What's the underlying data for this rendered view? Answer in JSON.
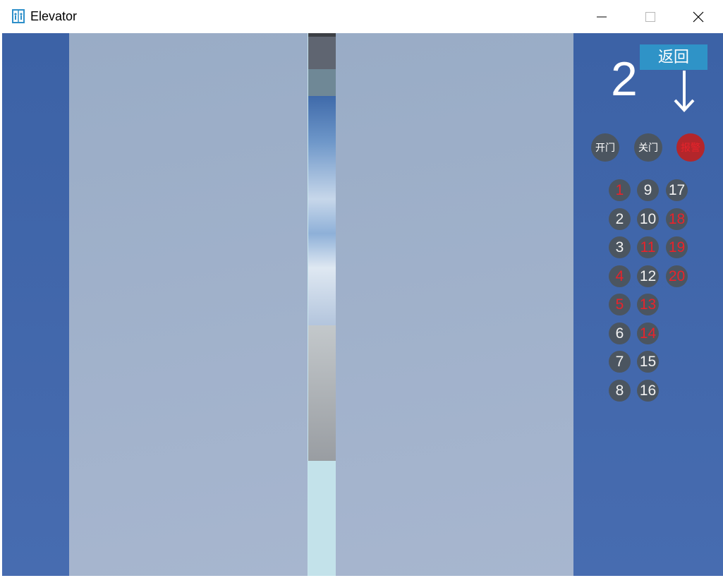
{
  "window": {
    "title": "Elevator"
  },
  "panel": {
    "current_floor": "2",
    "direction": "down",
    "return_label": "返回",
    "open_label": "开门",
    "close_label": "关门",
    "alarm_label": "报警"
  },
  "floors": [
    {
      "label": "1",
      "selected": true
    },
    {
      "label": "2",
      "selected": false
    },
    {
      "label": "3",
      "selected": false
    },
    {
      "label": "4",
      "selected": true
    },
    {
      "label": "5",
      "selected": true
    },
    {
      "label": "6",
      "selected": false
    },
    {
      "label": "7",
      "selected": false
    },
    {
      "label": "8",
      "selected": false
    },
    {
      "label": "9",
      "selected": false
    },
    {
      "label": "10",
      "selected": false
    },
    {
      "label": "11",
      "selected": true
    },
    {
      "label": "12",
      "selected": false
    },
    {
      "label": "13",
      "selected": true
    },
    {
      "label": "14",
      "selected": true
    },
    {
      "label": "15",
      "selected": false
    },
    {
      "label": "16",
      "selected": false
    },
    {
      "label": "17",
      "selected": false
    },
    {
      "label": "18",
      "selected": true
    },
    {
      "label": "19",
      "selected": true
    },
    {
      "label": "20",
      "selected": true
    }
  ],
  "colors": {
    "selected_text": "#e8232b",
    "normal_text": "#f2f2f2",
    "button_bg": "#4b5560",
    "alarm_bg": "#b3262b",
    "accent": "#2f93c7"
  }
}
